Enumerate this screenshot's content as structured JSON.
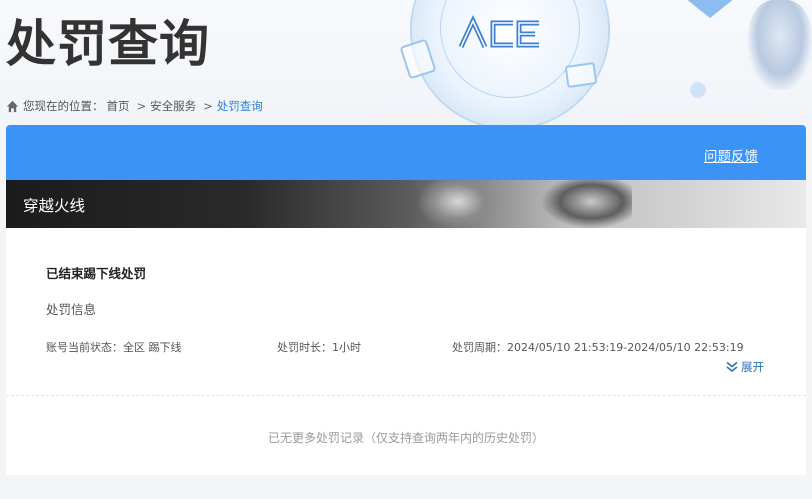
{
  "hero": {
    "title": "处罚查询"
  },
  "breadcrumb": {
    "prefix": "您现在的位置：",
    "items": [
      "首页",
      "安全服务",
      "处罚查询"
    ],
    "separator": ">"
  },
  "header": {
    "feedback_label": "问题反馈"
  },
  "game": {
    "name": "穿越火线"
  },
  "record": {
    "title": "已结束踢下线处罚",
    "subtitle": "处罚信息",
    "status": "账号当前状态：全区 踢下线",
    "duration": "处罚时长：1小时",
    "period": "处罚周期：2024/05/10 21:53:19-2024/05/10 22:53:19",
    "expand_label": "展开"
  },
  "footer": {
    "no_more": "已无更多处罚记录（仅支持查询两年内的历史处罚）"
  },
  "colors": {
    "header_blue": "#3b93f5",
    "link_blue": "#2d7fd6"
  },
  "icons": {
    "home": "home-icon",
    "expand": "double-chevron-down-icon"
  }
}
